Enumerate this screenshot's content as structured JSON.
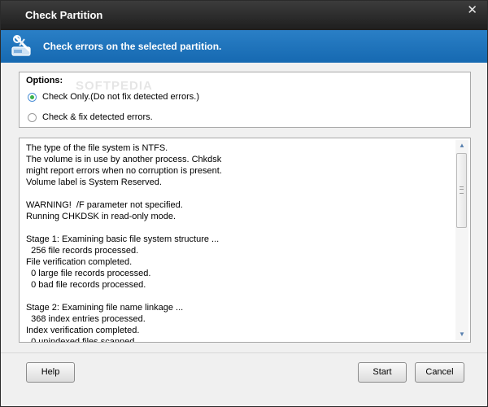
{
  "window": {
    "title": "Check Partition",
    "close_glyph": "✕"
  },
  "banner": {
    "text": "Check errors on the selected partition.",
    "icon": "partition-check-icon"
  },
  "options": {
    "heading": "Options:",
    "items": [
      {
        "label": "Check Only.(Do not fix detected errors.)",
        "selected": true
      },
      {
        "label": "Check & fix detected errors.",
        "selected": false
      }
    ],
    "watermark": "SOFTPEDIA"
  },
  "log": {
    "text": "The type of the file system is NTFS.\nThe volume is in use by another process. Chkdsk\nmight report errors when no corruption is present.\nVolume label is System Reserved.\n\nWARNING!  /F parameter not specified.\nRunning CHKDSK in read-only mode.\n\nStage 1: Examining basic file system structure ...\n  256 file records processed.\nFile verification completed.\n  0 large file records processed.\n  0 bad file records processed.\n\nStage 2: Examining file name linkage ...\n  368 index entries processed.\nIndex verification completed.\n  0 unindexed files scanned."
  },
  "buttons": {
    "help": "Help",
    "start": "Start",
    "cancel": "Cancel"
  },
  "colors": {
    "banner": "#1b6fb7",
    "titlebar": "#2d2d2d",
    "radio_selected": "#3bb24a"
  }
}
